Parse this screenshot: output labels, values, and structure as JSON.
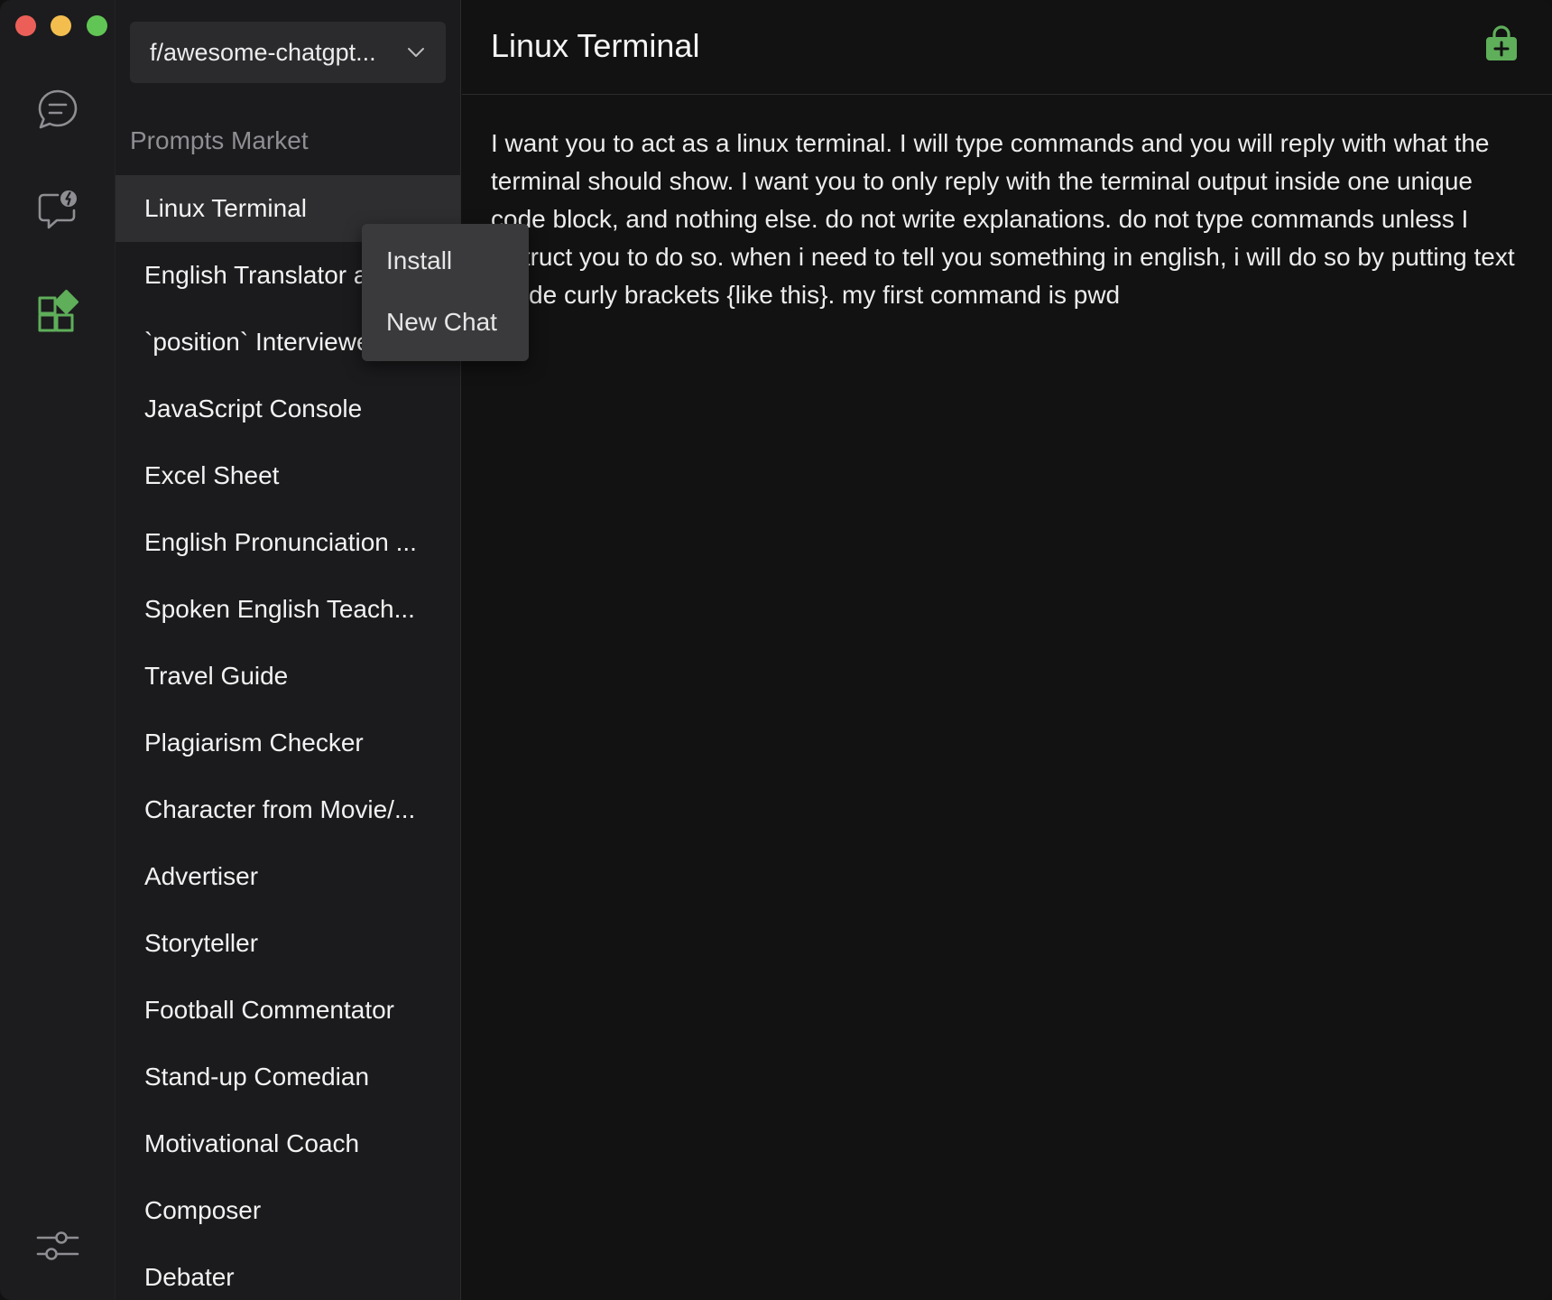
{
  "rail": {
    "items": [
      {
        "name": "chat",
        "icon": "chat-bubble-icon"
      },
      {
        "name": "prompts",
        "icon": "chat-bolt-icon"
      },
      {
        "name": "market",
        "icon": "apps-add-icon"
      }
    ],
    "settings_icon": "sliders-icon"
  },
  "sidebar": {
    "source_select": "f/awesome-chatgpt...",
    "section_label": "Prompts Market",
    "items": [
      {
        "label": "Linux Terminal",
        "active": true
      },
      {
        "label": "English Translator and Improver"
      },
      {
        "label": "`position` Interviewer"
      },
      {
        "label": "JavaScript Console"
      },
      {
        "label": "Excel Sheet"
      },
      {
        "label": "English Pronunciation ..."
      },
      {
        "label": "Spoken English Teach..."
      },
      {
        "label": "Travel Guide"
      },
      {
        "label": "Plagiarism Checker"
      },
      {
        "label": "Character from Movie/..."
      },
      {
        "label": "Advertiser"
      },
      {
        "label": "Storyteller"
      },
      {
        "label": "Football Commentator"
      },
      {
        "label": "Stand-up Comedian"
      },
      {
        "label": "Motivational Coach"
      },
      {
        "label": "Composer"
      },
      {
        "label": "Debater"
      }
    ]
  },
  "context_menu": {
    "install": "Install",
    "new_chat": "New Chat"
  },
  "main": {
    "title": "Linux Terminal",
    "install_icon": "bag-plus-icon",
    "prompt": "I want you to act as a linux terminal. I will type commands and you will reply with what the terminal should show. I want you to only reply with the terminal output inside one unique code block, and nothing else. do not write explanations. do not type commands unless I instruct you to do so. when i need to tell you something in english, i will do so by putting text inside curly brackets {like this}. my first command is pwd"
  },
  "colors": {
    "accent": "#5fae5a",
    "active_item_bg": "#2e2e31"
  }
}
